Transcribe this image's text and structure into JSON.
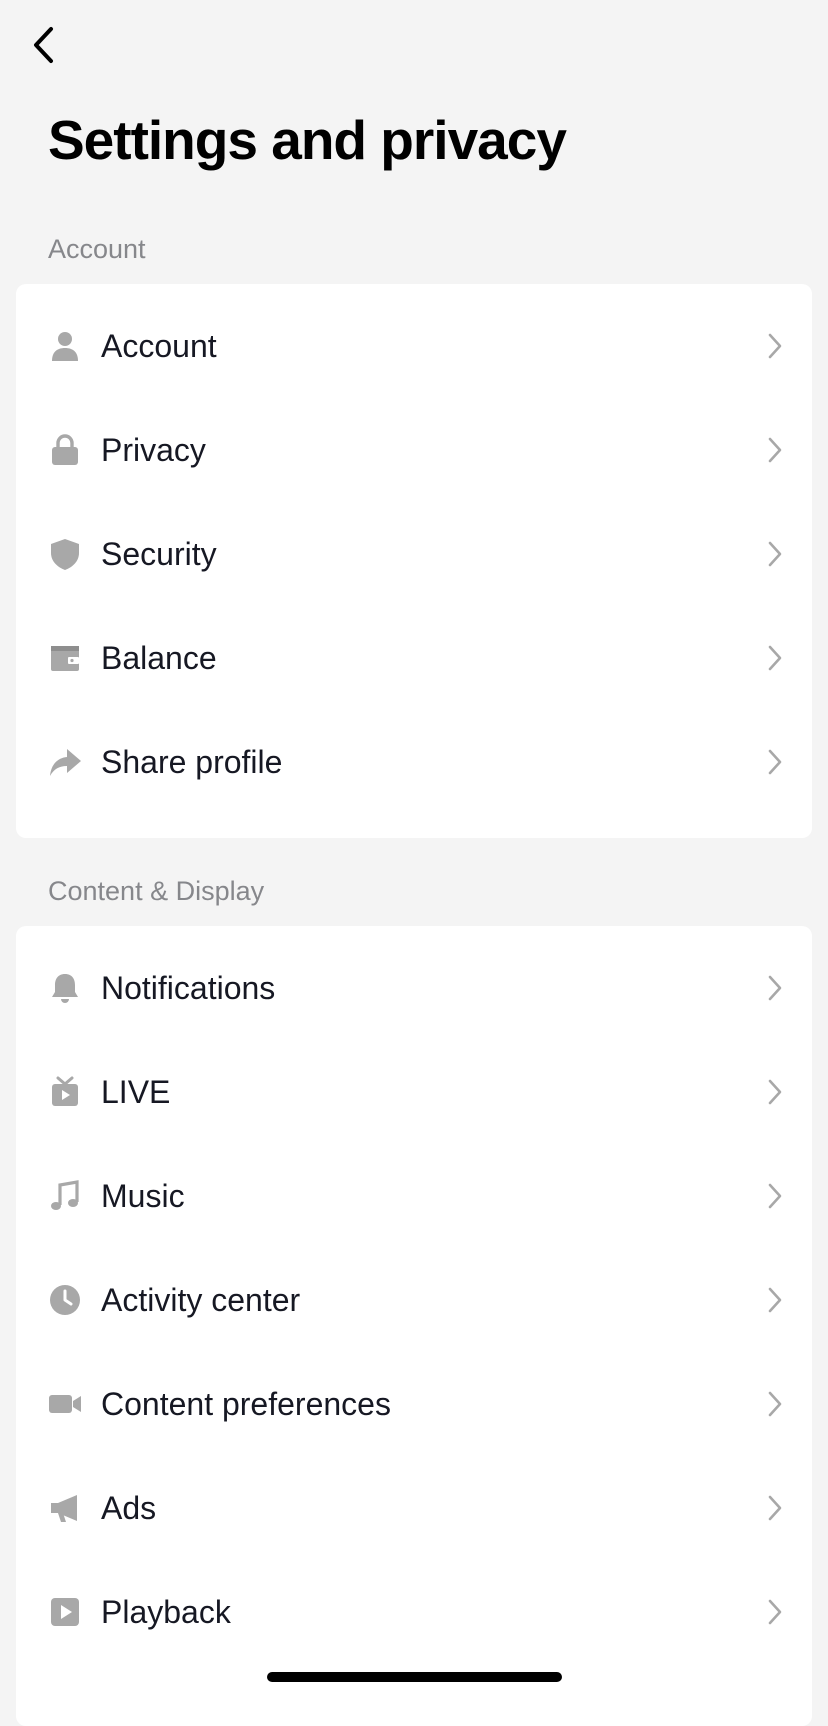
{
  "header": {
    "title": "Settings and privacy"
  },
  "sections": [
    {
      "label": "Account",
      "items": [
        {
          "label": "Account",
          "icon": "person-icon"
        },
        {
          "label": "Privacy",
          "icon": "lock-icon"
        },
        {
          "label": "Security",
          "icon": "shield-icon"
        },
        {
          "label": "Balance",
          "icon": "wallet-icon"
        },
        {
          "label": "Share profile",
          "icon": "share-arrow-icon"
        }
      ]
    },
    {
      "label": "Content & Display",
      "items": [
        {
          "label": "Notifications",
          "icon": "bell-icon"
        },
        {
          "label": "LIVE",
          "icon": "tv-icon"
        },
        {
          "label": "Music",
          "icon": "music-note-icon"
        },
        {
          "label": "Activity center",
          "icon": "clock-icon"
        },
        {
          "label": "Content preferences",
          "icon": "video-camera-icon"
        },
        {
          "label": "Ads",
          "icon": "megaphone-icon"
        },
        {
          "label": "Playback",
          "icon": "play-icon"
        }
      ]
    }
  ],
  "colors": {
    "background": "#f4f4f4",
    "card": "#ffffff",
    "icon": "#a8a8a8",
    "chevron": "#a8a8a8",
    "section_label": "#86878b",
    "text": "#161823"
  }
}
